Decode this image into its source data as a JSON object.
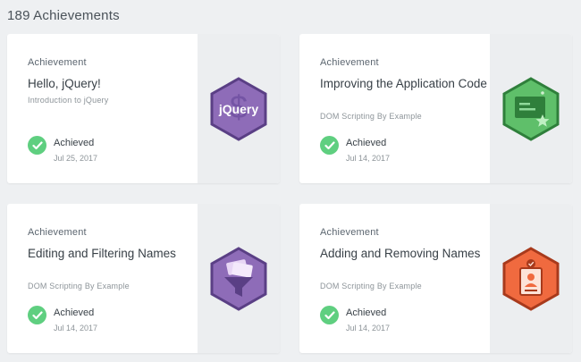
{
  "header": {
    "count_label": "189 Achievements"
  },
  "cards": [
    {
      "type": "Achievement",
      "title": "Hello, jQuery!",
      "subtitle": "Introduction to jQuery",
      "status": "Achieved",
      "date": "Jul 25, 2017",
      "badge": {
        "icon": "jquery-badge-icon",
        "text": "jQuery",
        "color": "#8e6cb8",
        "border": "#5a3f85"
      }
    },
    {
      "type": "Achievement",
      "title": "Improving the Application Code",
      "subtitle": "DOM Scripting By Example",
      "status": "Achieved",
      "date": "Jul 14, 2017",
      "badge": {
        "icon": "code-window-badge-icon",
        "color": "#5fbf6a",
        "border": "#2f7f3b"
      }
    },
    {
      "type": "Achievement",
      "title": "Editing and Filtering Names",
      "subtitle": "DOM Scripting By Example",
      "status": "Achieved",
      "date": "Jul 14, 2017",
      "badge": {
        "icon": "funnel-badge-icon",
        "color": "#8e6cb8",
        "border": "#5a3f85"
      }
    },
    {
      "type": "Achievement",
      "title": "Adding and Removing Names",
      "subtitle": "DOM Scripting By Example",
      "status": "Achieved",
      "date": "Jul 14, 2017",
      "badge": {
        "icon": "id-card-badge-icon",
        "color": "#f06a3f",
        "border": "#a83a1c"
      }
    }
  ],
  "colors": {
    "achieved_check": "#5fcf80",
    "background": "#eef0f2",
    "badge_panel": "#eceef0"
  }
}
